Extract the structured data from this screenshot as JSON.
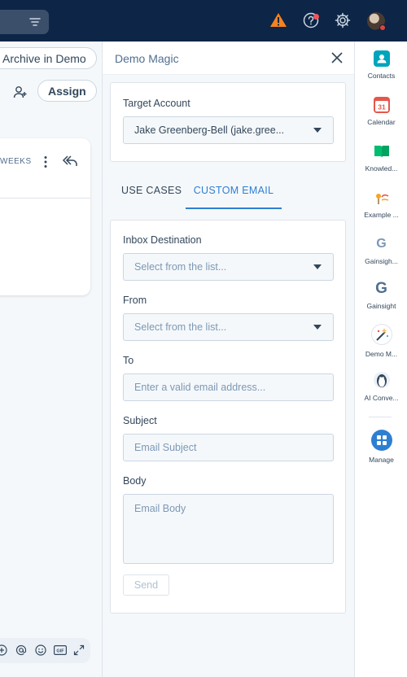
{
  "left": {
    "archive_label": "Archive in Demo",
    "assign_label": "Assign",
    "conversation_card": {
      "time_label": "WEEKS"
    },
    "composer_toolbar": {
      "gif_label": "GIF"
    }
  },
  "panel": {
    "title": "Demo Magic",
    "target_account": {
      "label": "Target Account",
      "selected": "Jake Greenberg-Bell (jake.gree..."
    },
    "tabs": [
      {
        "label": "USE CASES",
        "active": false
      },
      {
        "label": "CUSTOM EMAIL",
        "active": true
      }
    ],
    "form": {
      "inbox_label": "Inbox Destination",
      "inbox_placeholder": "Select from the list...",
      "from_label": "From",
      "from_placeholder": "Select from the list...",
      "to_label": "To",
      "to_placeholder": "Enter a valid email address...",
      "subject_label": "Subject",
      "subject_placeholder": "Email Subject",
      "body_label": "Body",
      "body_placeholder": "Email Body",
      "send_label": "Send"
    }
  },
  "rail": {
    "items": [
      {
        "label": "Contacts",
        "icon": "contacts-icon",
        "color": "#00a4bd"
      },
      {
        "label": "Calendar",
        "icon": "calendar-icon",
        "color": "#e5574b",
        "day": "31"
      },
      {
        "label": "Knowled...",
        "icon": "knowledge-icon",
        "color": "#00bd6f"
      },
      {
        "label": "Example ...",
        "icon": "example-app-icon",
        "color": "#f5a623"
      },
      {
        "label": "Gainsigh...",
        "icon": "gainsight-icon",
        "color": "#7c98b6",
        "letter": "G"
      },
      {
        "label": "Gainsight",
        "icon": "gainsight-icon",
        "color": "#516f90",
        "letter": "G"
      },
      {
        "label": "Demo M...",
        "icon": "demo-magic-icon",
        "color": "#33475b"
      },
      {
        "label": "AI Conve...",
        "icon": "ai-conversation-icon",
        "color": "#99acc2"
      }
    ],
    "manage_label": "Manage"
  },
  "colors": {
    "topbar": "#0d2547",
    "accent": "#2e7fd2",
    "warning": "#f5821f"
  }
}
